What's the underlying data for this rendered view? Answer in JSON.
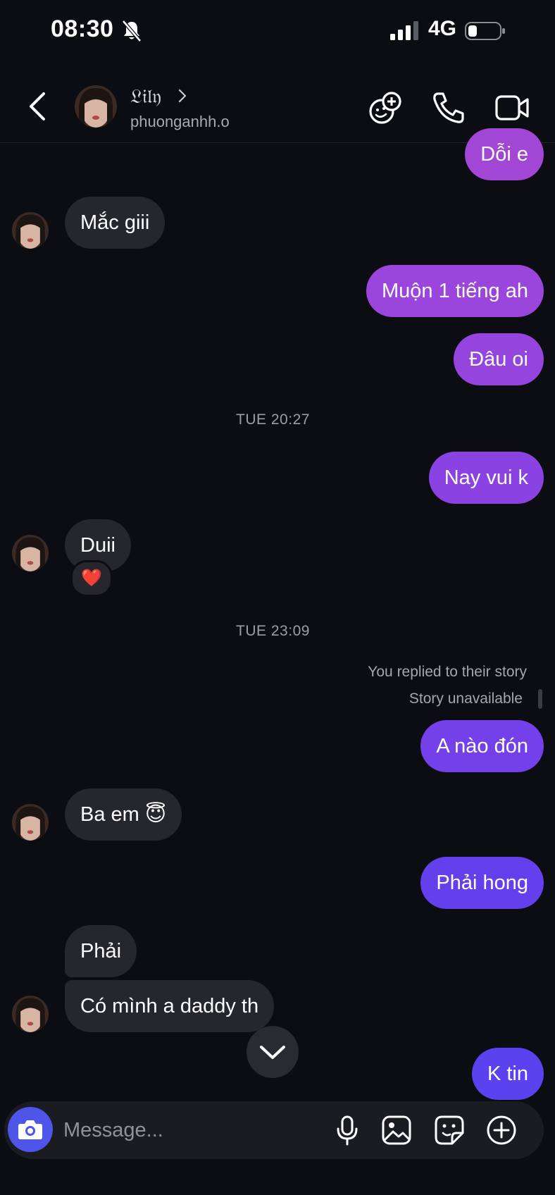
{
  "status_bar": {
    "time": "08:30",
    "network": "4G"
  },
  "header": {
    "display_name": "𝔏𝔦𝔩𝔶",
    "username": "phuonganhh.o"
  },
  "messages": [
    {
      "side": "out",
      "text": "Dỗi e",
      "color": "#a246d6"
    },
    {
      "side": "in",
      "text": "Mắc giii"
    },
    {
      "side": "out",
      "text": "Muộn 1 tiếng ah",
      "color": "#9a45dc"
    },
    {
      "side": "out",
      "text": "Đâu oi",
      "color": "#9544de"
    },
    {
      "side": "out",
      "text": "Nay vui k",
      "color": "#8a42e2"
    },
    {
      "side": "in",
      "text": "Duii",
      "reaction": "❤️"
    },
    {
      "side": "out",
      "text": "A nào đón",
      "color": "#7340ea"
    },
    {
      "side": "in",
      "text": "Ba em 😇"
    },
    {
      "side": "out",
      "text": "Phải hong",
      "color": "#6440ec"
    },
    {
      "side": "in",
      "text": "Phải"
    },
    {
      "side": "in",
      "text": "Có mình a daddy th"
    },
    {
      "side": "out",
      "text": "K tin",
      "color": "#5a42ee"
    }
  ],
  "timestamps": [
    "TUE 20:27",
    "TUE 23:09"
  ],
  "story_reply": {
    "line1": "You replied to their story",
    "line2": "Story unavailable"
  },
  "composer": {
    "placeholder": "Message..."
  },
  "colors": {
    "background": "#0c0d12",
    "incoming_bubble": "#26272d",
    "camera_button": "#4f55e8"
  }
}
